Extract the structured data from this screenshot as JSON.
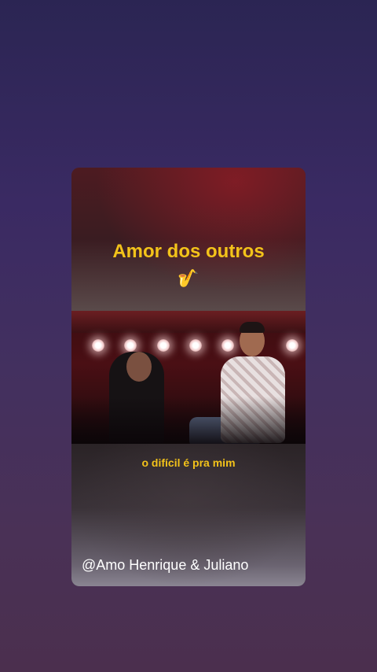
{
  "card": {
    "title": "Amor dos outros",
    "emoji": "🎷",
    "subtitle": "o difícil é pra mim",
    "handle": "@Amo Henrique & Juliano"
  },
  "colors": {
    "accent_text": "#f3c31a",
    "background_top": "#2b2553",
    "background_bottom": "#4b2f4e"
  }
}
